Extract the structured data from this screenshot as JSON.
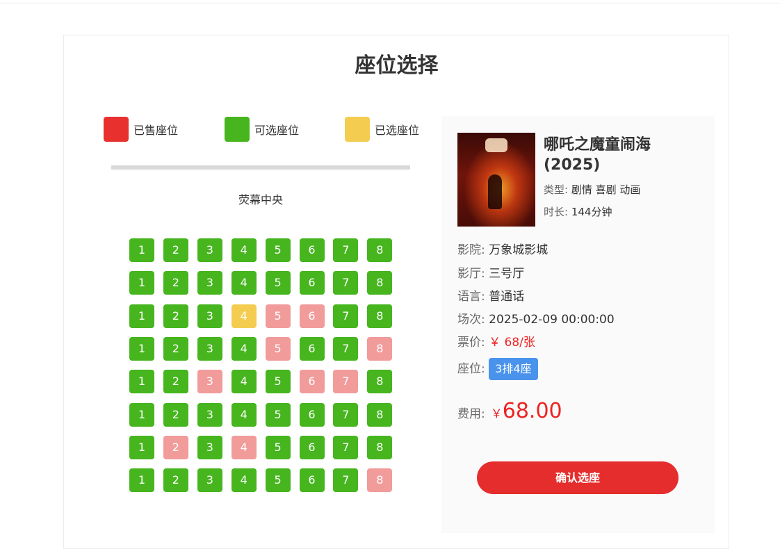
{
  "page_title": "座位选择",
  "colors": {
    "sold": "#e8302f",
    "available": "#46b51e",
    "selected": "#f4cd50",
    "sold_seat": "#f19b9b",
    "accent": "#4a93ec",
    "confirm": "#e52d2d"
  },
  "legend": [
    {
      "label": "已售座位",
      "color": "#e8302f"
    },
    {
      "label": "可选座位",
      "color": "#46b51e"
    },
    {
      "label": "已选座位",
      "color": "#f4cd50"
    }
  ],
  "screen_label": "荧幕中央",
  "seat_rows": [
    [
      "a",
      "a",
      "a",
      "a",
      "a",
      "a",
      "a",
      "a"
    ],
    [
      "a",
      "a",
      "a",
      "a",
      "a",
      "a",
      "a",
      "a"
    ],
    [
      "a",
      "a",
      "a",
      "s",
      "x",
      "x",
      "a",
      "a"
    ],
    [
      "a",
      "a",
      "a",
      "a",
      "x",
      "a",
      "a",
      "x"
    ],
    [
      "a",
      "a",
      "x",
      "a",
      "a",
      "x",
      "x",
      "a"
    ],
    [
      "a",
      "a",
      "a",
      "a",
      "a",
      "a",
      "a",
      "a"
    ],
    [
      "a",
      "x",
      "a",
      "x",
      "a",
      "a",
      "a",
      "a"
    ],
    [
      "a",
      "a",
      "a",
      "a",
      "a",
      "a",
      "a",
      "x"
    ]
  ],
  "seat_labels": [
    "1",
    "2",
    "3",
    "4",
    "5",
    "6",
    "7",
    "8"
  ],
  "movie": {
    "title": "哪吒之魔童闹海(2025)",
    "genre_label": "类型:",
    "genre_value": "剧情 喜剧 动画",
    "duration_label": "时长:",
    "duration_value": "144分钟"
  },
  "info": {
    "cinema_label": "影院:",
    "cinema_value": "万象城影城",
    "hall_label": "影厅:",
    "hall_value": "三号厅",
    "language_label": "语言:",
    "language_value": "普通话",
    "session_label": "场次:",
    "session_value": "2025-02-09 00:00:00",
    "price_label": "票价:",
    "price_value": "￥ 68/张",
    "seat_label": "座位:",
    "seat_value": "3排4座"
  },
  "fee": {
    "label": "费用:",
    "currency": "￥",
    "value": "68.00"
  },
  "confirm_label": "确认选座"
}
